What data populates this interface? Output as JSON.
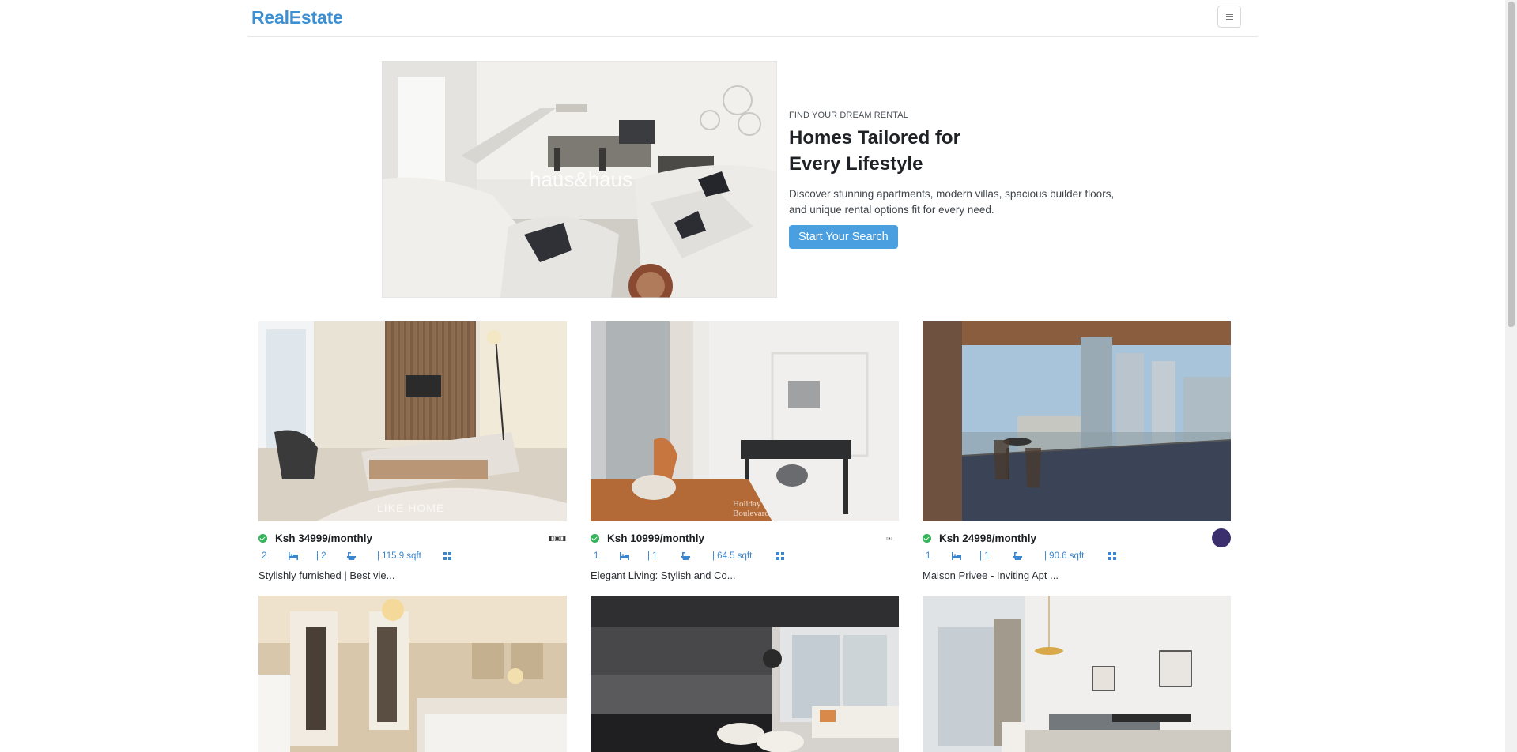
{
  "brand": "RealEstate",
  "hero": {
    "eyebrow": "FIND YOUR DREAM RENTAL",
    "title": "Homes Tailored for Every Lifestyle",
    "description": "Discover stunning apartments, modern villas, spacious builder floors, and unique rental options fit for every need.",
    "cta": "Start Your Search",
    "image_watermark": "haus&haus"
  },
  "listings": [
    {
      "price": "Ksh 34999/monthly",
      "beds": "2",
      "baths": "| 2",
      "area": "| 115.9 sqft",
      "title": "Stylishly furnished | Best vie...",
      "verified": true,
      "photo_watermark": "LIKE HOME"
    },
    {
      "price": "Ksh 10999/monthly",
      "beds": "1",
      "baths": "| 1",
      "area": "| 64.5 sqft",
      "title": "Elegant Living: Stylish and Co...",
      "verified": true,
      "photo_watermark": "Holiday Boulevard"
    },
    {
      "price": "Ksh 24998/monthly",
      "beds": "1",
      "baths": "| 1",
      "area": "| 90.6 sqft",
      "title": "Maison Privee - Inviting Apt ...",
      "verified": true,
      "photo_watermark": ""
    }
  ],
  "colors": {
    "brand": "#3d8fd1",
    "button": "#4a9fe0",
    "verified": "#34b35a",
    "meta": "#3a86cf"
  },
  "icons": [
    "menu-icon",
    "check-circle-icon",
    "bed-icon",
    "bath-icon",
    "grid-icon"
  ]
}
